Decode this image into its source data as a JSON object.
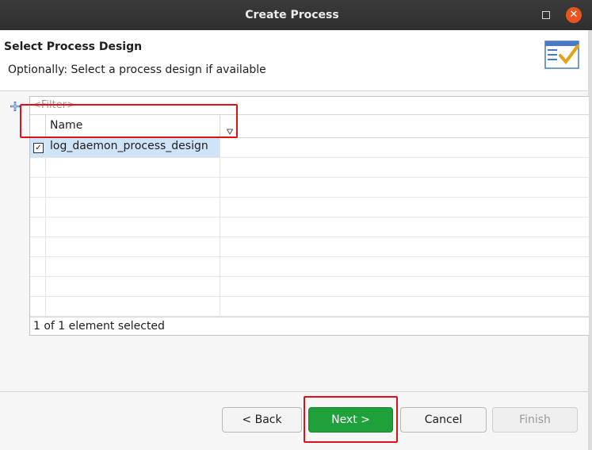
{
  "window": {
    "title": "Create Process"
  },
  "header": {
    "title": "Select Process Design",
    "message": "Optionally: Select a process design if available"
  },
  "table": {
    "filter_placeholder": "<Filter>",
    "column_name": "Name",
    "rows": [
      {
        "name": "log_daemon_process_design",
        "checked": true,
        "selected": true
      }
    ],
    "status": "1 of 1 element selected"
  },
  "buttons": {
    "back": "< Back",
    "next": "Next >",
    "cancel": "Cancel",
    "finish": "Finish"
  },
  "colors": {
    "next_button": "#1ea13a",
    "highlight": "#e0101a",
    "close_button": "#e95420"
  }
}
